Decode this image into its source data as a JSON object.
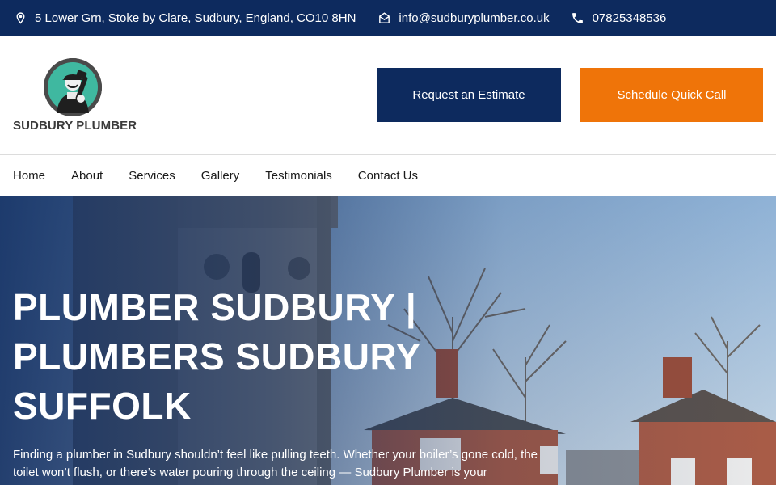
{
  "topbar": {
    "address": "5 Lower Grn, Stoke by Clare, Sudbury, England, CO10 8HN",
    "email": "info@sudburyplumber.co.uk",
    "phone": "07825348536",
    "address_icon": "map-pin-icon",
    "email_icon": "envelope-open-icon",
    "phone_icon": "phone-icon"
  },
  "header": {
    "logo_text": "SUDBURY PLUMBER",
    "estimate_label": "Request an Estimate",
    "call_label": "Schedule Quick Call"
  },
  "nav": {
    "items": [
      "Home",
      "About",
      "Services",
      "Gallery",
      "Testimonials",
      "Contact Us"
    ]
  },
  "hero": {
    "title": "PLUMBER SUDBURY | PLUMBERS SUDBURY SUFFOLK",
    "text": "Finding a plumber in Sudbury shouldn’t feel like pulling teeth. Whether your boiler’s gone cold, the toilet won’t flush, or there’s water pouring through the ceiling — Sudbury Plumber is your"
  },
  "colors": {
    "brand_navy": "#0d2a5e",
    "brand_orange": "#ef7409",
    "logo_teal": "#3fb8a0"
  }
}
